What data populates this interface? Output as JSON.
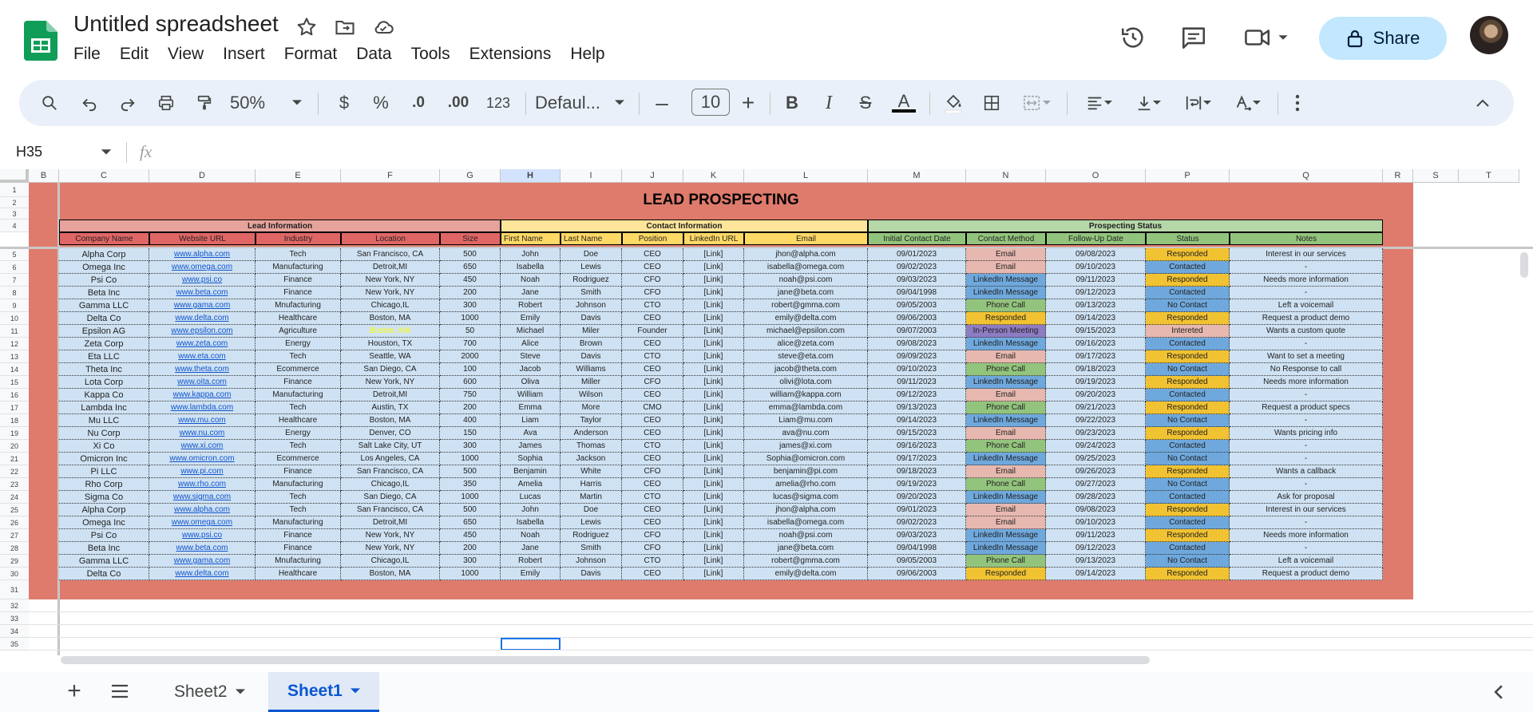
{
  "doc": {
    "title": "Untitled spreadsheet"
  },
  "menu": [
    "File",
    "Edit",
    "View",
    "Insert",
    "Format",
    "Data",
    "Tools",
    "Extensions",
    "Help"
  ],
  "share": {
    "label": "Share"
  },
  "toolbar": {
    "zoom": "50%",
    "currency": "$",
    "percent": "%",
    "dec_less": ".0",
    "dec_more": ".00",
    "number_format": "123",
    "font": "Defaul...",
    "font_size": "10"
  },
  "formula_bar": {
    "name_box": "H35",
    "fx": "fx"
  },
  "columns": [
    "B",
    "C",
    "D",
    "E",
    "F",
    "G",
    "H",
    "I",
    "J",
    "K",
    "L",
    "M",
    "N",
    "O",
    "P",
    "Q",
    "R",
    "S",
    "T"
  ],
  "sheet": {
    "title": "LEAD PROSPECTING",
    "groups": [
      "Lead Information",
      "Contact Information",
      "Prospecting Status"
    ],
    "headers": [
      "Company Name",
      "Website URL",
      "Industry",
      "Location",
      "Size",
      "First Name",
      "Last Name",
      "Position",
      "LinkedIn URL",
      "Email",
      "Initial Contact Date",
      "Contact Method",
      "Follow-Up Date",
      "Status",
      "Notes"
    ],
    "rows": [
      [
        "Alpha Corp",
        "www.alpha.com",
        "Tech",
        "San Francisco, CA",
        "500",
        "John",
        "Doe",
        "CEO",
        "[Link]",
        "jhon@alpha.com",
        "09/01/2023",
        "Email",
        "09/08/2023",
        "Responded",
        "Interest in our services"
      ],
      [
        "Omega Inc",
        "www.omega.com",
        "Manufacturing",
        "Detroit,MI",
        "650",
        "Isabella",
        "Lewis",
        "CEO",
        "[Link]",
        "isabella@omega.com",
        "09/02/2023",
        "Email",
        "09/10/2023",
        "Contacted",
        "-"
      ],
      [
        "Psi Co",
        "www.psi.co",
        "Finance",
        "New York, NY",
        "450",
        "Noah",
        "Rodriguez",
        "CFO",
        "[Link]",
        "noah@psi.com",
        "09/03/2023",
        "LinkedIn Message",
        "09/11/2023",
        "Responded",
        "Needs more information"
      ],
      [
        "Beta Inc",
        "www.beta.com",
        "Finance",
        "New York, NY",
        "200",
        "Jane",
        "Smith",
        "CFO",
        "[Link]",
        "jane@beta.com",
        "09/04/1998",
        "LinkedIn Message",
        "09/12/2023",
        "Contacted",
        "-"
      ],
      [
        "Gamma LLC",
        "www.gama.com",
        "Mnufacturing",
        "Chicago,IL",
        "300",
        "Robert",
        "Johnson",
        "CTO",
        "[Link]",
        "robert@gmma.com",
        "09/05/2003",
        "Phone Call",
        "09/13/2023",
        "No Contact",
        "Left a voicemail"
      ],
      [
        "Delta Co",
        "www.delta.com",
        "Healthcare",
        "Boston, MA",
        "1000",
        "Emily",
        "Davis",
        "CEO",
        "[Link]",
        "emily@delta.com",
        "09/06/2003",
        "Responded",
        "09/14/2023",
        "Responded",
        "Request a product demo"
      ],
      [
        "Epsilon AG",
        "www.epsilon.com",
        "Agriculture",
        "Boston, MA",
        "50",
        "Michael",
        "Miler",
        "Founder",
        "[Link]",
        "michael@epsilon.com",
        "09/07/2003",
        "In-Person Meeting",
        "09/15/2023",
        "Intereted",
        "Wants a custom quote"
      ],
      [
        "Zeta Corp",
        "www.zeta.com",
        "Energy",
        "Houston, TX",
        "700",
        "Alice",
        "Brown",
        "CEO",
        "[Link]",
        "alice@zeta.com",
        "09/08/2023",
        "LinkedIn Message",
        "09/16/2023",
        "Contacted",
        "-"
      ],
      [
        "Eta LLC",
        "www.eta.com",
        "Tech",
        "Seattle, WA",
        "2000",
        "Steve",
        "Davis",
        "CTO",
        "[Link]",
        "steve@eta.com",
        "09/09/2023",
        "Email",
        "09/17/2023",
        "Responded",
        "Want to set a meeting"
      ],
      [
        "Theta Inc",
        "www.theta.com",
        "Ecommerce",
        "San Diego, CA",
        "100",
        "Jacob",
        "Williams",
        "CEO",
        "[Link]",
        "jacob@theta.com",
        "09/10/2023",
        "Phone Call",
        "09/18/2023",
        "No Contact",
        "No Response to call"
      ],
      [
        "Lota Corp",
        "www.oita.com",
        "Finance",
        "New York, NY",
        "600",
        "Oliva",
        "Miller",
        "CFO",
        "[Link]",
        "olivi@lota.com",
        "09/11/2023",
        "LinkedIn Message",
        "09/19/2023",
        "Responded",
        "Needs more information"
      ],
      [
        "Kappa Co",
        "www.kappa.com",
        "Manufacturing",
        "Detroit,MI",
        "750",
        "William",
        "Wilson",
        "CEO",
        "[Link]",
        "william@kappa.com",
        "09/12/2023",
        "Email",
        "09/20/2023",
        "Contacted",
        "-"
      ],
      [
        "Lambda Inc",
        "www.lambda.com",
        "Tech",
        "Austin, TX",
        "200",
        "Emma",
        "More",
        "CMO",
        "[Link]",
        "emma@lambda.com",
        "09/13/2023",
        "Phone Call",
        "09/21/2023",
        "Responded",
        "Request a product specs"
      ],
      [
        "Mu LLC",
        "www.mu.com",
        "Healthcare",
        "Boston, MA",
        "400",
        "Liam",
        "Taylor",
        "CEO",
        "[Link]",
        "Liam@mu.com",
        "09/14/2023",
        "LinkedIn Message",
        "09/22/2023",
        "No Contact",
        "-"
      ],
      [
        "Nu Corp",
        "www.nu.com",
        "Energy",
        "Denver, CO",
        "150",
        "Ava",
        "Anderson",
        "CEO",
        "[Link]",
        "ava@nu.com",
        "09/15/2023",
        "Email",
        "09/23/2023",
        "Responded",
        "Wants pricing info"
      ],
      [
        "Xi Co",
        "www.xi.com",
        "Tech",
        "Salt Lake City, UT",
        "300",
        "James",
        "Thomas",
        "CTO",
        "[Link]",
        "james@xi.com",
        "09/16/2023",
        "Phone Call",
        "09/24/2023",
        "Contacted",
        "-"
      ],
      [
        "Omicron Inc",
        "www.omicron.com",
        "Ecommerce",
        "Los Angeles, CA",
        "1000",
        "Sophia",
        "Jackson",
        "CEO",
        "[Link]",
        "Sophia@omicron.com",
        "09/17/2023",
        "LinkedIn Message",
        "09/25/2023",
        "No Contact",
        "-"
      ],
      [
        "Pi LLC",
        "www.pi.com",
        "Finance",
        "San Francisco, CA",
        "500",
        "Benjamin",
        "White",
        "CFO",
        "[Link]",
        "benjamin@pi.com",
        "09/18/2023",
        "Email",
        "09/26/2023",
        "Responded",
        "Wants a callback"
      ],
      [
        "Rho Corp",
        "www.rho.com",
        "Manufacturing",
        "Chicago,IL",
        "350",
        "Amelia",
        "Harris",
        "CEO",
        "[Link]",
        "amelia@rho.com",
        "09/19/2023",
        "Phone Call",
        "09/27/2023",
        "No Contact",
        "-"
      ],
      [
        "Sigma Co",
        "www.sigma.com",
        "Tech",
        "San Diego, CA",
        "1000",
        "Lucas",
        "Martin",
        "CTO",
        "[Link]",
        "lucas@sigma.com",
        "09/20/2023",
        "LinkedIn Message",
        "09/28/2023",
        "Contacted",
        "Ask for proposal"
      ],
      [
        "Alpha Corp",
        "www.alpha.com",
        "Tech",
        "San Francisco, CA",
        "500",
        "John",
        "Doe",
        "CEO",
        "[Link]",
        "jhon@alpha.com",
        "09/01/2023",
        "Email",
        "09/08/2023",
        "Responded",
        "Interest in our services"
      ],
      [
        "Omega Inc",
        "www.omega.com",
        "Manufacturing",
        "Detroit,MI",
        "650",
        "Isabella",
        "Lewis",
        "CEO",
        "[Link]",
        "isabella@omega.com",
        "09/02/2023",
        "Email",
        "09/10/2023",
        "Contacted",
        "-"
      ],
      [
        "Psi Co",
        "www.psi.co",
        "Finance",
        "New York, NY",
        "450",
        "Noah",
        "Rodriguez",
        "CFO",
        "[Link]",
        "noah@psi.com",
        "09/03/2023",
        "LinkedIn Message",
        "09/11/2023",
        "Responded",
        "Needs more information"
      ],
      [
        "Beta Inc",
        "www.beta.com",
        "Finance",
        "New York, NY",
        "200",
        "Jane",
        "Smith",
        "CFO",
        "[Link]",
        "jane@beta.com",
        "09/04/1998",
        "LinkedIn Message",
        "09/12/2023",
        "Contacted",
        "-"
      ],
      [
        "Gamma LLC",
        "www.gama.com",
        "Mnufacturing",
        "Chicago,IL",
        "300",
        "Robert",
        "Johnson",
        "CTO",
        "[Link]",
        "robert@gmma.com",
        "09/05/2003",
        "Phone Call",
        "09/13/2023",
        "No Contact",
        "Left a voicemail"
      ],
      [
        "Delta Co",
        "www.delta.com",
        "Healthcare",
        "Boston, MA",
        "1000",
        "Emily",
        "Davis",
        "CEO",
        "[Link]",
        "emily@delta.com",
        "09/06/2003",
        "Responded",
        "09/14/2023",
        "Responded",
        "Request a product demo"
      ]
    ]
  },
  "method_colors": {
    "Email": "#e6b8af",
    "LinkedIn Message": "#6fa8dc",
    "Phone Call": "#93c47d",
    "Responded": "#f1c232",
    "In-Person Meeting": "#8e7cc3"
  },
  "status_colors": {
    "Responded": "#f1c232",
    "Contacted": "#6fa8dc",
    "No Contact": "#6fa8dc",
    "Intereted": "#e6b8af"
  },
  "colors": {
    "frame": "#df7b6c",
    "lead_hdr": "#e6a39c",
    "lead_sub": "#e06666",
    "contact_hdr": "#ffe599",
    "contact_sub": "#ffd966",
    "status_hdr": "#b6d7a8",
    "status_sub": "#93c47d",
    "body": "#cfe2f3",
    "highlight_text": "#ffff00"
  },
  "tabs": [
    {
      "label": "Sheet2"
    },
    {
      "label": "Sheet1"
    }
  ]
}
